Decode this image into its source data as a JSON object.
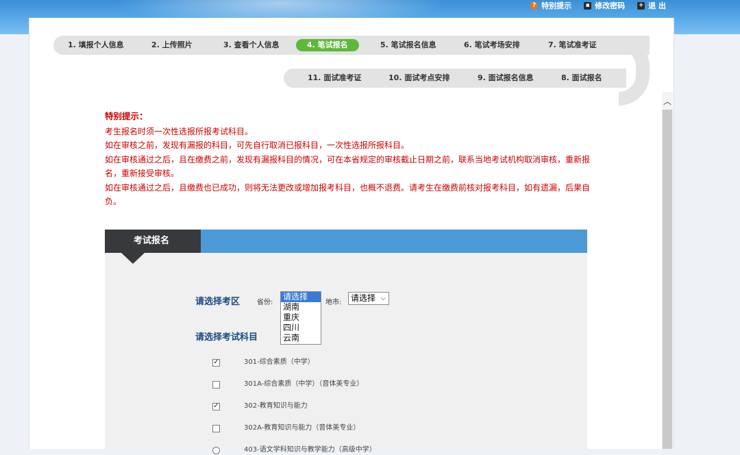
{
  "top_links": [
    {
      "label": "特别提示",
      "icon": "help-icon"
    },
    {
      "label": "修改密码",
      "icon": "lock-icon"
    },
    {
      "label": "退 出",
      "icon": "exit-icon"
    }
  ],
  "steps": {
    "row1": [
      "1. 填报个人信息",
      "2. 上传照片",
      "3. 查看个人信息",
      "4. 笔试报名",
      "5. 笔试报名信息",
      "6. 笔试考场安排",
      "7. 笔试准考证"
    ],
    "row2": [
      "11. 面试准考证",
      "10. 面试考点安排",
      "9. 面试报名信息",
      "8. 面试报名"
    ],
    "active": "4. 笔试报名",
    "active_color": "#5fb83c"
  },
  "notice": {
    "title": "特别提示：",
    "lines": [
      "考生报名时须一次性选报所报考试科目。",
      "如在审核之前，发现有漏报的科目，可先自行取消已报科目，一次性选报所报科目。",
      "如在审核通过之后，且在缴费之前，发现有漏报科目的情况，可在本省规定的审核截止日期之前，联系当地考试机构取消审核，重新报名，重新接受审核。",
      "如在审核通过之后，且缴费也已成功，则将无法更改或增加报考科目，也概不退费。请考生在缴费前核对报考科目，如有遗漏，后果自负。"
    ],
    "color": "#cc0000"
  },
  "panel": {
    "tab_label": "考试报名",
    "region_label": "请选择考区",
    "province_label": "省份:",
    "province_options": [
      "请选择",
      "湖南",
      "重庆",
      "四川",
      "云南"
    ],
    "province_selected": "请选择",
    "city_label": "地市:",
    "city_value": "请选择",
    "subject_label": "请选择考试科目",
    "subjects": [
      {
        "text": "301-综合素质（中学）",
        "control": "checkbox",
        "checked": true
      },
      {
        "text": "301A-综合素质（中学）（音体美专业）",
        "control": "checkbox",
        "checked": false
      },
      {
        "text": "302-教育知识与能力",
        "control": "checkbox",
        "checked": true
      },
      {
        "text": "302A-教育知识与能力（音体美专业）",
        "control": "checkbox",
        "checked": false
      },
      {
        "text": "403-语文学科知识与教学能力（高级中学）",
        "control": "radio",
        "checked": false
      }
    ],
    "bar_color": "#4c9ad8",
    "tab_color": "#37393c"
  }
}
